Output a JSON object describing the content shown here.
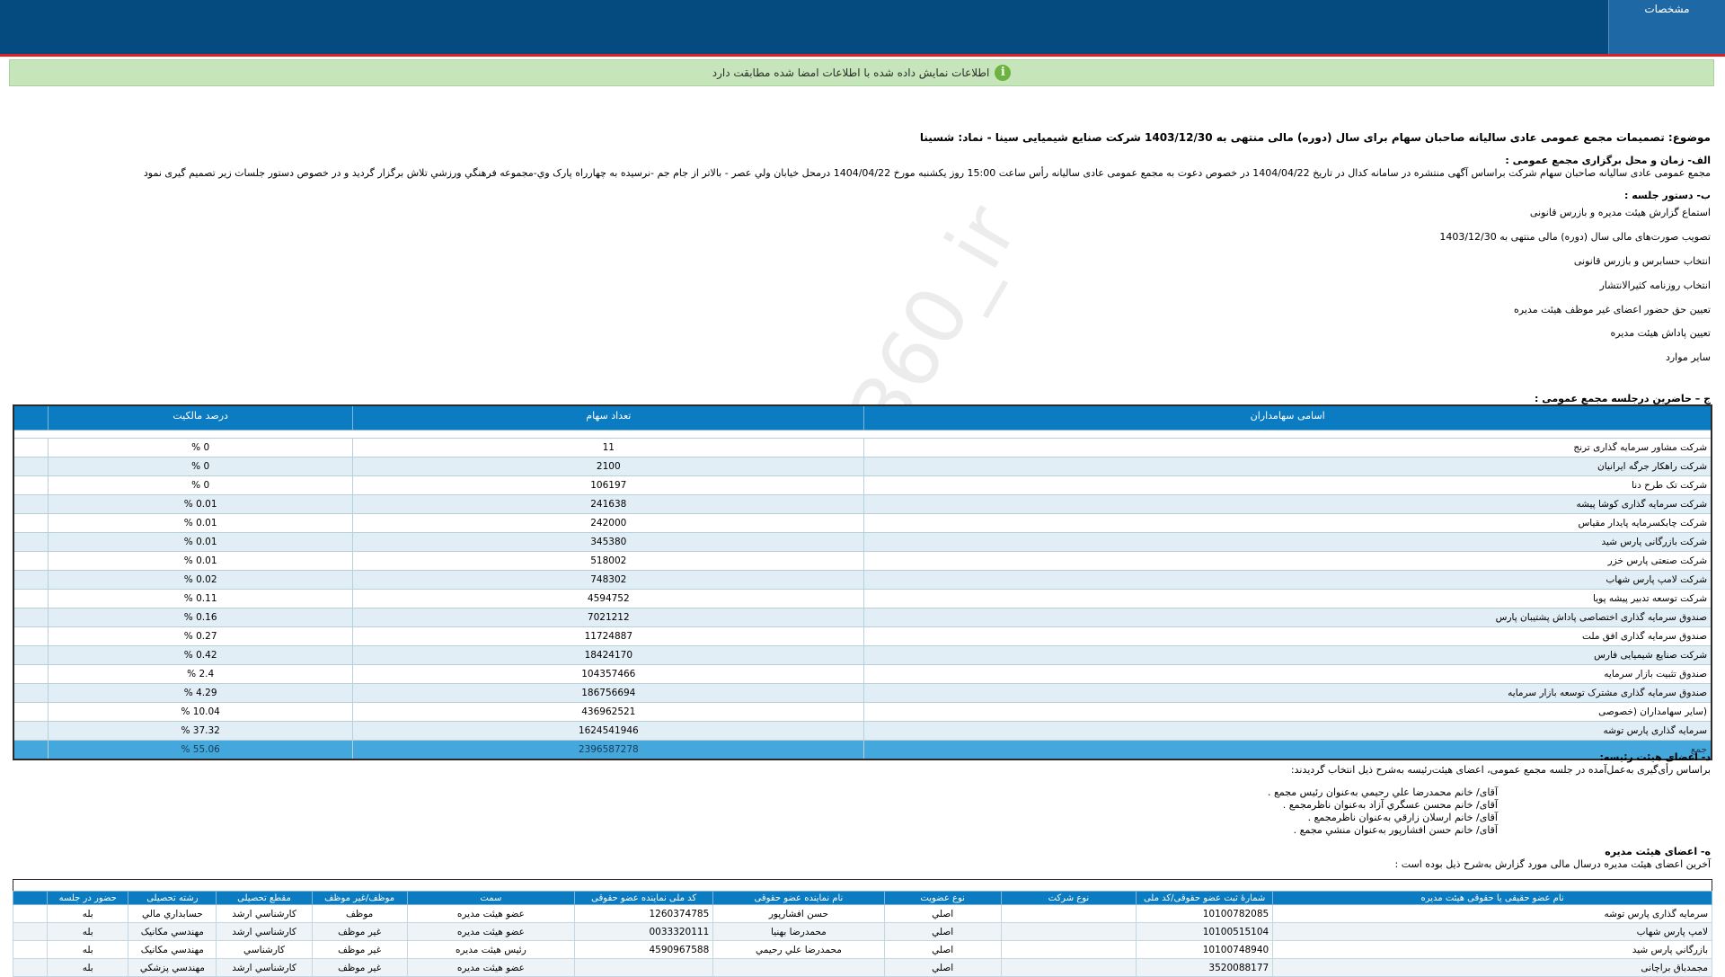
{
  "header": {
    "tab_label": "مشخصات"
  },
  "notice": {
    "text": "اطلاعات نمایش داده شده با اطلاعات امضا شده مطابقت دارد",
    "icon": "info-icon",
    "color": "#6cb33f"
  },
  "subject": "موضوع: تصمیمات مجمع عمومی عادی سالیانه صاحبان سهام برای سال (دوره) مالی منتهی به 1403/12/30 شرکت صنایع شیمیایی سینا - نماد: شسینا",
  "section_a": {
    "title": "الف- زمان و محل برگزاری مجمع عمومی :",
    "text": "مجمع عمومی عادی سالیانه صاحبان سهام شرکت براساس آگهی منتشره در سامانه کدال در تاریخ 1404/04/22 در خصوص دعوت به مجمع عمومی عادی سالیانه رأس ساعت 15:00 روز یکشنبه مورخ 1404/04/22 درمحل  خیابان ولي عصر - بالاتر از جام جم -نرسيده به چهارراه پارک وي-مجموعه فرهنگي ورزشي تلاش   برگزار گردید و در خصوص دستور جلسات زیر تصمیم گیری نمود"
  },
  "section_b": {
    "title": "ب- دستور جلسه :",
    "items": [
      "استماع گزارش هیئت مدیره و بازرس قانونی",
      "تصویب صورت‌های مالی سال (دوره) مالی منتهی به 1403/12/30",
      "انتخاب حسابرس و بازرس قانونی",
      "انتخاب روزنامه کثیرالانتشار",
      "تعیین حق حضور اعضای غیر موظف هیئت مدیره",
      "تعیین پاداش هیئت مدیره",
      "سایر موارد"
    ]
  },
  "section_c": {
    "title": "ج – حاضرین درجلسه مجمع عمومی :",
    "headers": [
      "اسامی سهامداران",
      "تعداد سهام",
      "درصد مالکیت"
    ],
    "rows": [
      [
        "شرکت مشاور سرمایه گذاری ترنج",
        "11",
        "0 %"
      ],
      [
        "شرکت راهکار جرگه ایرانیان",
        "2100",
        "0 %"
      ],
      [
        "شرکت تک طرح دنا",
        "106197",
        "0 %"
      ],
      [
        "شرکت سرمایه گذاری کوشا پیشه",
        "241638",
        "0.01 %"
      ],
      [
        "شرکت چابکسرمایه پایدار مقیاس",
        "242000",
        "0.01 %"
      ],
      [
        "شرکت بازرگانی پارس شید",
        "345380",
        "0.01 %"
      ],
      [
        "شرکت صنعتی پارس خزر",
        "518002",
        "0.01 %"
      ],
      [
        "شرکت لامپ پارس شهاب",
        "748302",
        "0.02 %"
      ],
      [
        "شرکت توسعه تدبیر پیشه پویا",
        "4594752",
        "0.11 %"
      ],
      [
        "صندوق سرمایه گذاری اختصاصی پاداش پشتیبان پارس",
        "7021212",
        "0.16 %"
      ],
      [
        "صندوق سرمایه گذاری افق ملت",
        "11724887",
        "0.27 %"
      ],
      [
        "شرکت صنایع شیمیایی فارس",
        "18424170",
        "0.42 %"
      ],
      [
        "صندوق تثبیت بازار سرمایه",
        "104357466",
        "2.4 %"
      ],
      [
        "صندوق سرمایه گذاری مشترک توسعه بازار سرمایه",
        "186756694",
        "4.29 %"
      ],
      [
        "(سایر سهامداران (خصوصی",
        "436962521",
        "10.04 %"
      ],
      [
        "سرمایه گذاری پارس توشه",
        "1624541946",
        "37.32 %"
      ]
    ],
    "total": [
      "جمع",
      "2396587278",
      "55.06 %"
    ]
  },
  "section_d": {
    "title": "د- اعضای هیئت رئیسه:",
    "intro": "براساس رأی‌گیری به‌عمل‌آمده در جلسه مجمع عمومی، اعضای هیئت‌رئیسه به‌شرح ذیل انتخاب گردیدند:",
    "members": [
      "آقای/ خانم  محمدرضا علي رحيمي  به‌عنوان رئیس مجمع .",
      "آقای/ خانم  محسن عسگري آزاد  به‌عنوان ناظرمجمع .",
      "آقای/ خانم  ارسلان زارقي  به‌عنوان ناظرمجمع .",
      "آقای/ خانم  حسن افشارپور  به‌عنوان منشي مجمع ."
    ]
  },
  "section_e": {
    "title": "ه- اعضای هیئت مدیره",
    "intro": "آخرین اعضای هیئت مدیره درسال مالی مورد گزارش به‌شرح ذیل بوده است :",
    "headers": [
      "نام عضو حقیقی یا حقوقی هیئت مدیره",
      "شمارهٔ ثبت عضو حقوقی/کد ملی",
      "نوع شرکت",
      "نوع عضویت",
      "نام نماینده عضو حقوقی",
      "کد ملی نماینده عضو حقوقی",
      "سمت",
      "موظف/غیر موظف",
      "مقطع تحصیلی",
      "رشته تحصیلی",
      "حضور در جلسه"
    ],
    "rows": [
      [
        "سرمایه گذاری پارس توشه",
        "10100782085",
        "",
        "اصلي",
        "حسن افشارپور",
        "1260374785",
        "عضو هیئت مدیره",
        "موظف",
        "کارشناسي ارشد",
        "حسابداري مالي",
        "بله"
      ],
      [
        "لامپ پارس شهاب",
        "10100515104",
        "",
        "اصلي",
        "محمدرضا بهنيا",
        "0033320111",
        "عضو هیئت مدیره",
        "غیر موظف",
        "کارشناسي ارشد",
        "مهندسي مکانيک",
        "بله"
      ],
      [
        "بازرگاني پارس شيد",
        "10100748940",
        "",
        "اصلي",
        "محمدرضا علي رحيمي",
        "4590967588",
        "رئیس هیئت مدیره",
        "غیر موظف",
        "کارشناسي",
        "مهندسي مکانيک",
        "بله"
      ],
      [
        "مجمدباق براچانی",
        "3520088177",
        "",
        "اصلي",
        "",
        "",
        "عضو هیئت مدیره",
        "غیر موظف",
        "کارشناسي ارشد",
        "مهندسي پزشکي",
        "بله"
      ]
    ]
  },
  "watermark": "@Codal360_ir"
}
